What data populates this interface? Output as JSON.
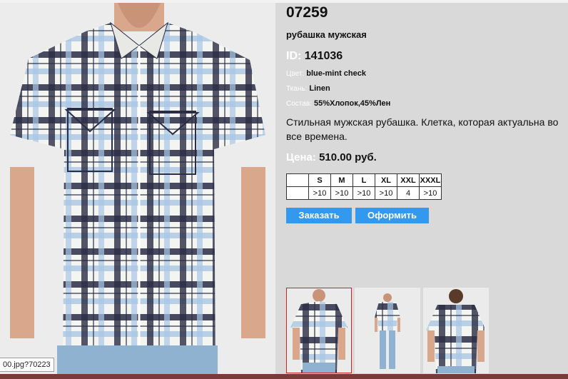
{
  "product": {
    "code": "07259",
    "name": "рубашка мужская",
    "id_label": "ID:",
    "id_value": "141036",
    "color_label": "Цвет:",
    "color_value": "blue-mint check",
    "fabric_label": "Ткань:",
    "fabric_value": "Linen",
    "composition_label": "Состав:",
    "composition_value": "55%Хлопок,45%Лен",
    "description": "Стильная мужская рубашка. Клетка, которая актуальна во все времена.",
    "price_label": "Цена:",
    "price_value": "510.00 руб."
  },
  "sizes": {
    "headers": [
      "S",
      "M",
      "L",
      "XL",
      "XXL",
      "XXXL"
    ],
    "quantities": [
      ">10",
      ">10",
      ">10",
      ">10",
      "4",
      ">10"
    ]
  },
  "buttons": {
    "order": "Заказать",
    "checkout": "Оформить"
  },
  "status_tip": "00.jpg?70223",
  "colors": {
    "background": "#d9d9d9",
    "button": "#3399ee",
    "selected_thumb_border": "#cc2222",
    "shirt_check_dark": "#2a2d45",
    "shirt_check_light": "#a9c6e4"
  }
}
